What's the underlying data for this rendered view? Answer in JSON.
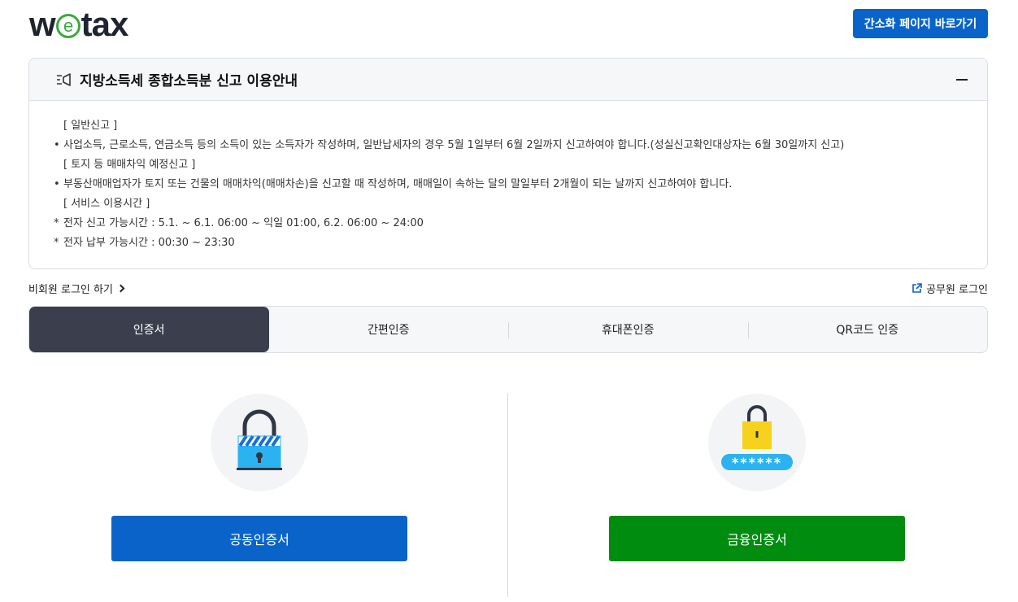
{
  "header": {
    "logo_prefix": "w",
    "logo_e": "e",
    "logo_suffix": "tax",
    "simple_page_button": "간소화 페이지 바로가기"
  },
  "notice": {
    "title": "지방소득세 종합소득분 신고 이용안내",
    "lines": [
      {
        "bullet": "",
        "text": "[ 일반신고 ]"
      },
      {
        "bullet": "•",
        "text": "사업소득, 근로소득, 연금소득 등의 소득이 있는 소득자가 작성하며, 일반납세자의 경우 5월 1일부터 6월 2일까지 신고하여야 합니다.(성실신고확인대상자는 6월 30일까지 신고)"
      },
      {
        "bullet": "",
        "text": "[ 토지 등 매매차익 예정신고 ]"
      },
      {
        "bullet": "•",
        "text": "부동산매매업자가 토지 또는 건물의 매매차익(매매차손)을 신고할 때 작성하며, 매매일이 속하는 달의 말일부터 2개월이 되는 날까지 신고하여야 합니다."
      },
      {
        "bullet": "",
        "text": "[ 서비스 이용시간 ]"
      },
      {
        "bullet": "*",
        "text": "전자 신고 가능시간 : 5.1. ~ 6.1. 06:00 ~ 익일 01:00,    6.2. 06:00 ~ 24:00"
      },
      {
        "bullet": "*",
        "text": "전자 납부 가능시간 : 00:30 ~ 23:30"
      }
    ]
  },
  "links": {
    "nonmember_login": "비회원 로그인 하기",
    "official_login": "공무원 로그인"
  },
  "tabs": [
    "인증서",
    "간편인증",
    "휴대폰인증",
    "QR코드 인증"
  ],
  "active_tab": 0,
  "certificates": {
    "joint_button": "공동인증서",
    "financial_button": "금융인증서",
    "password_mask": "******"
  },
  "colors": {
    "primary_blue": "#0a63c9",
    "financial_green": "#008c0e",
    "active_tab": "#3b3e4d"
  }
}
